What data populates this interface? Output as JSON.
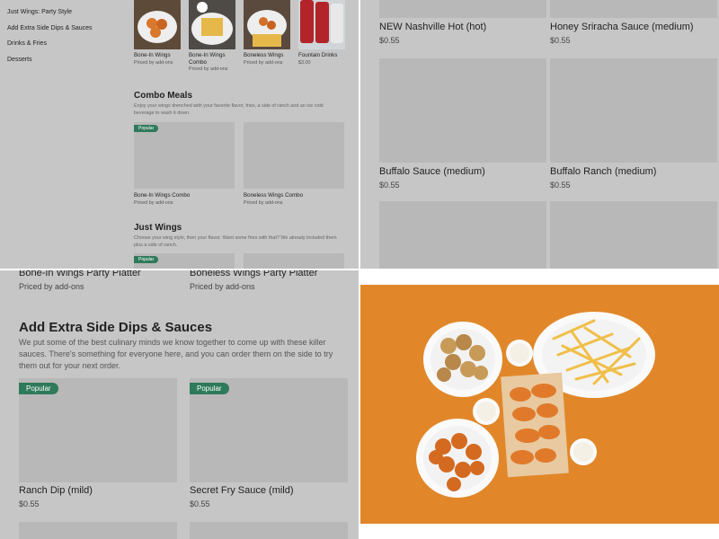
{
  "sidebar": {
    "items": [
      {
        "label": "Just Wings: Party Style"
      },
      {
        "label": "Add Extra Side Dips & Sauces"
      },
      {
        "label": "Drinks & Fries"
      },
      {
        "label": "Desserts"
      }
    ]
  },
  "top_products": [
    {
      "name": "Bone-In Wings",
      "price": "Priced by add-ons"
    },
    {
      "name": "Bone-In Wings Combo",
      "price": "Priced by add-ons"
    },
    {
      "name": "Boneless Wings",
      "price": "Priced by add-ons"
    },
    {
      "name": "Fountain Drinks",
      "price": "$3.00"
    }
  ],
  "combo_meals": {
    "title": "Combo Meals",
    "description": "Enjoy your wings drenched with your favorite flavor, fries, a side of ranch and an ice cold beverage to wash it down.",
    "items": [
      {
        "name": "Bone-In Wings Combo",
        "price": "Priced by add-ons",
        "badge": "Popular"
      },
      {
        "name": "Boneless Wings Combo",
        "price": "Priced by add-ons",
        "badge": ""
      }
    ]
  },
  "just_wings": {
    "title": "Just Wings",
    "description": "Choose your wing style, then your flavor. Want some fries with that? We already included them plus a side of ranch.",
    "badge": "Popular"
  },
  "sauces_top": [
    {
      "name": "NEW Nashville Hot (hot)",
      "price": "$0.55"
    },
    {
      "name": "Honey Sriracha Sauce (medium)",
      "price": "$0.55"
    },
    {
      "name": "Buffalo Sauce (medium)",
      "price": "$0.55"
    },
    {
      "name": "Buffalo Ranch (medium)",
      "price": "$0.55"
    }
  ],
  "platters": [
    {
      "name": "Bone-In Wings Party Platter",
      "price": "Priced by add-ons"
    },
    {
      "name": "Boneless Wings Party Platter",
      "price": "Priced by add-ons"
    }
  ],
  "extra_sides": {
    "title": "Add Extra Side Dips & Sauces",
    "description": "We put some of the best culinary minds we know together to come up with these killer sauces. There's something for everyone here, and you can order them on the side to try them out for your next order.",
    "items": [
      {
        "name": "Ranch Dip (mild)",
        "price": "$0.55",
        "badge": "Popular"
      },
      {
        "name": "Secret Fry Sauce (mild)",
        "price": "$0.55",
        "badge": "Popular"
      }
    ]
  },
  "colors": {
    "overlay": "#c6c6c6",
    "badge_green": "#2f7a5a",
    "photo_orange": "#e08a2e"
  }
}
